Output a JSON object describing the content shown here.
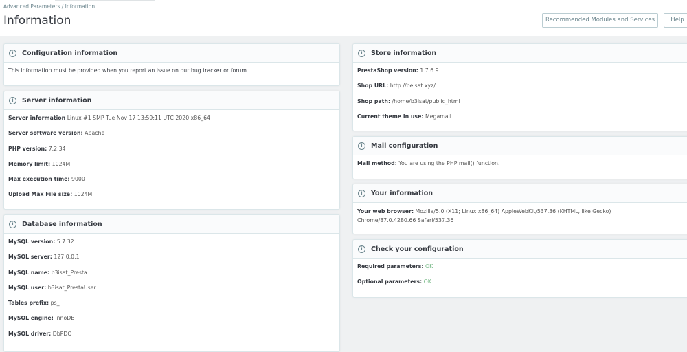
{
  "header": {
    "breadcrumb": [
      "Advanced Parameters",
      "Information"
    ],
    "breadcrumb_sep": "/",
    "title": "Information",
    "recommended_button": "Recommended Modules and Services",
    "help_button": "Help"
  },
  "colors": {
    "ok": "#70b580",
    "border": "#dbe6e9"
  },
  "left": {
    "config": {
      "title": "Configuration information",
      "text": "This information must be provided when you report an issue on our bug tracker or forum."
    },
    "server": {
      "title": "Server information",
      "rows": [
        {
          "label": "Server information",
          "value": "Linux #1 SMP Tue Nov 17 13:59:11 UTC 2020 x86_64"
        },
        {
          "label": "Server software version:",
          "value": "Apache"
        },
        {
          "label": "PHP version:",
          "value": "7.2.34"
        },
        {
          "label": "Memory limit:",
          "value": "1024M"
        },
        {
          "label": "Max execution time:",
          "value": "9000"
        },
        {
          "label": "Upload Max File size:",
          "value": "1024M"
        }
      ]
    },
    "database": {
      "title": "Database information",
      "rows": [
        {
          "label": "MySQL version:",
          "value": "5.7.32"
        },
        {
          "label": "MySQL server:",
          "value": "127.0.0.1"
        },
        {
          "label": "MySQL name:",
          "value": "b3isat_Presta"
        },
        {
          "label": "MySQL user:",
          "value": "b3isat_PrestaUser"
        },
        {
          "label": "Tables prefix:",
          "value": "ps_"
        },
        {
          "label": "MySQL engine:",
          "value": "InnoDB"
        },
        {
          "label": "MySQL driver:",
          "value": "DbPDO"
        }
      ]
    }
  },
  "right": {
    "store": {
      "title": "Store information",
      "rows": [
        {
          "label": "PrestaShop version:",
          "value": "1.7.6.9"
        },
        {
          "label": "Shop URL:",
          "value": "http://beisat.xyz/"
        },
        {
          "label": "Shop path:",
          "value": "/home/b3isat/public_html"
        },
        {
          "label": "Current theme in use:",
          "value": "Megamall"
        }
      ]
    },
    "mail": {
      "title": "Mail configuration",
      "rows": [
        {
          "label": "Mail method:",
          "value": "You are using the PHP mail() function."
        }
      ]
    },
    "you": {
      "title": "Your information",
      "rows": [
        {
          "label": "Your web browser:",
          "value": "Mozilla/5.0 (X11; Linux x86_64) AppleWebKit/537.36 (KHTML, like Gecko) Chrome/87.0.4280.66 Safari/537.36"
        }
      ]
    },
    "check": {
      "title": "Check your configuration",
      "rows": [
        {
          "label": "Required parameters:",
          "value": "OK"
        },
        {
          "label": "Optional parameters:",
          "value": "OK"
        }
      ]
    }
  }
}
